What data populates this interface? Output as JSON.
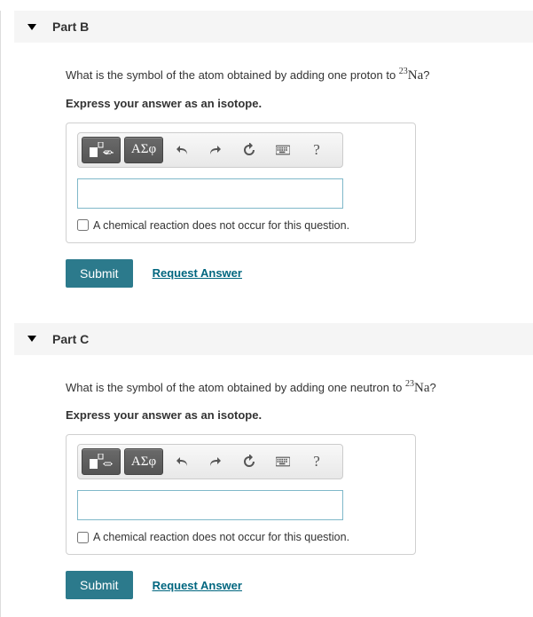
{
  "parts": [
    {
      "id": "B",
      "title": "Part B",
      "question_prefix": "What is the symbol of the atom obtained by adding one proton to ",
      "isotope_html": "<sup>23</sup>Na",
      "question_suffix": "?",
      "instruction": "Express your answer as an isotope.",
      "toolbar": {
        "greek": "ΑΣφ",
        "help": "?"
      },
      "checkbox_label": "A chemical reaction does not occur for this question.",
      "submit": "Submit",
      "request": "Request Answer"
    },
    {
      "id": "C",
      "title": "Part C",
      "question_prefix": "What is the symbol of the atom obtained by adding one neutron to ",
      "isotope_html": "<sup>23</sup>Na",
      "question_suffix": "?",
      "instruction": "Express your answer as an isotope.",
      "toolbar": {
        "greek": "ΑΣφ",
        "help": "?"
      },
      "checkbox_label": "A chemical reaction does not occur for this question.",
      "submit": "Submit",
      "request": "Request Answer"
    }
  ],
  "chart_data": null
}
